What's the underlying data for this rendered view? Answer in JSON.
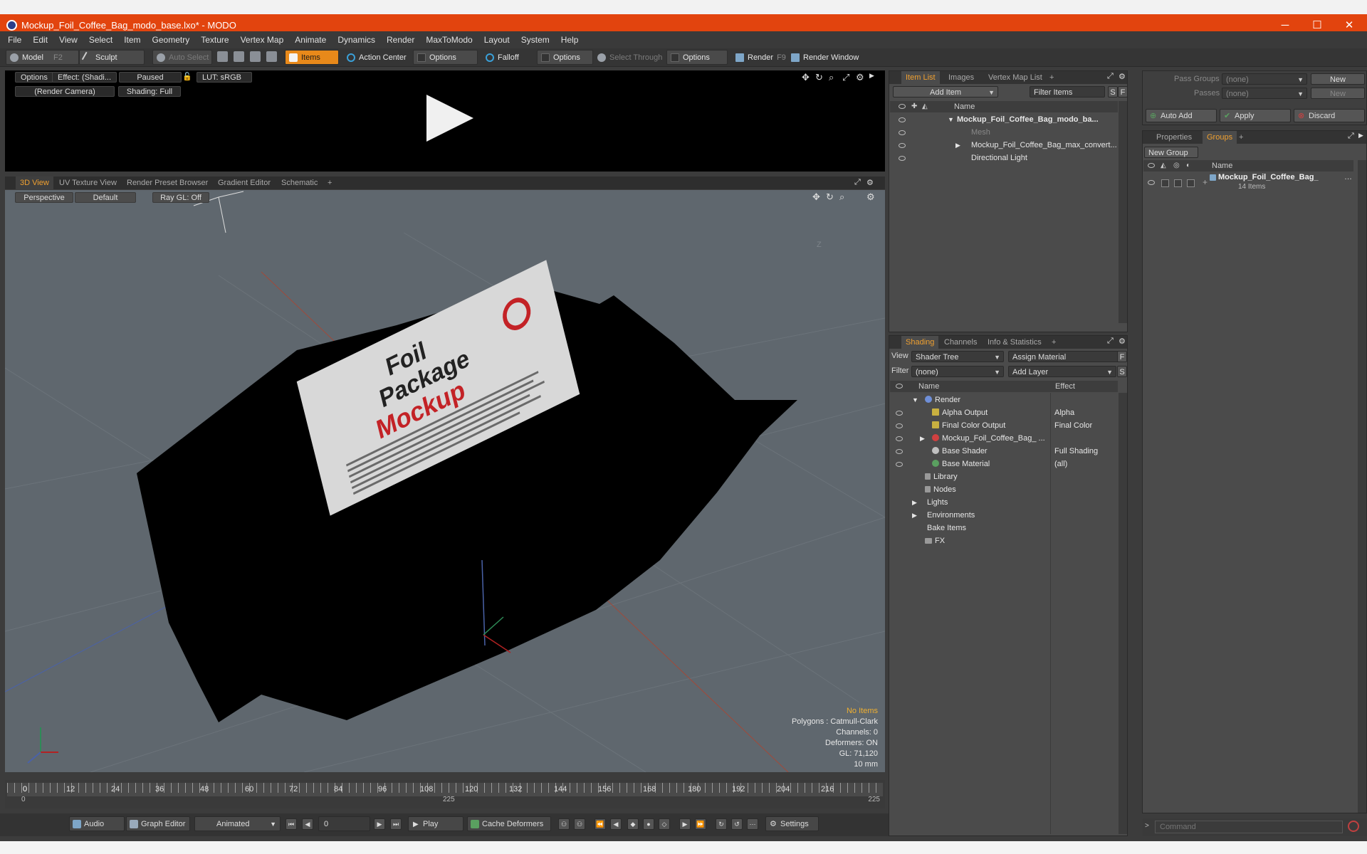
{
  "window": {
    "title": "Mockup_Foil_Coffee_Bag_modo_base.lxo* - MODO",
    "minimize": "─",
    "maximize": "☐",
    "close": "✕"
  },
  "menu": [
    "File",
    "Edit",
    "View",
    "Select",
    "Item",
    "Geometry",
    "Texture",
    "Vertex Map",
    "Animate",
    "Dynamics",
    "Render",
    "MaxToModo",
    "Layout",
    "System",
    "Help"
  ],
  "toolbar": {
    "model": "Model",
    "model_key": "F2",
    "sculpt": "Sculpt",
    "auto_select": "Auto Select",
    "items": "Items",
    "action_center": "Action Center",
    "options1": "Options",
    "falloff": "Falloff",
    "options2": "Options",
    "select_through": "Select Through",
    "options3": "Options",
    "render": "Render",
    "render_key": "F9",
    "render_window": "Render Window"
  },
  "preview": {
    "options": "Options",
    "effect": "Effect: (Shadi...",
    "paused": "Paused",
    "lut": "LUT: sRGB",
    "camera": "(Render Camera)",
    "shading": "Shading: Full"
  },
  "viewport_tabs": [
    "3D View",
    "UV Texture View",
    "Render Preset Browser",
    "Gradient Editor",
    "Schematic",
    "+"
  ],
  "viewport": {
    "perspective": "Perspective",
    "default": "Default",
    "raygl": "Ray GL: Off",
    "axis_label": "Z",
    "package_text": {
      "line1": "Foil",
      "line2": "Package",
      "line3": "Mockup"
    },
    "info": {
      "no_items": "No Items",
      "polygons": "Polygons : Catmull-Clark",
      "channels": "Channels: 0",
      "deformers": "Deformers: ON",
      "gl": "GL: 71,120",
      "unit": "10 mm"
    }
  },
  "timeline": {
    "ticks": [
      "0",
      "12",
      "24",
      "36",
      "48",
      "60",
      "72",
      "84",
      "96",
      "108",
      "120",
      "132",
      "144",
      "156",
      "168",
      "180",
      "192",
      "204",
      "216"
    ],
    "range_start": "0",
    "range_mid": "225",
    "range_end": "225"
  },
  "bottombar": {
    "audio": "Audio",
    "graph_editor": "Graph Editor",
    "animated": "Animated",
    "frame": "0",
    "play": "Play",
    "cache_deformers": "Cache Deformers",
    "settings": "Settings"
  },
  "item_list": {
    "tabs": [
      "Item List",
      "Images",
      "Vertex Map List",
      "+"
    ],
    "add_item": "Add Item",
    "filter_items": "Filter Items",
    "s": "S",
    "f": "F",
    "col_name": "Name",
    "rows": [
      "Mockup_Foil_Coffee_Bag_modo_ba...",
      "Mesh",
      "Mockup_Foil_Coffee_Bag_max_convert...",
      "Directional Light"
    ]
  },
  "shading": {
    "tabs": [
      "Shading",
      "Channels",
      "Info & Statistics",
      "+"
    ],
    "view_label": "View",
    "view_value": "Shader Tree",
    "assign_material": "Assign Material",
    "f": "F",
    "filter_label": "Filter",
    "filter_value": "(none)",
    "add_layer": "Add Layer",
    "s": "S",
    "col_name": "Name",
    "col_effect": "Effect",
    "rows": [
      {
        "name": "Render",
        "effect": ""
      },
      {
        "name": "Alpha Output",
        "effect": "Alpha"
      },
      {
        "name": "Final Color Output",
        "effect": "Final Color"
      },
      {
        "name": "Mockup_Foil_Coffee_Bag_ ...",
        "effect": ""
      },
      {
        "name": "Base Shader",
        "effect": "Full Shading"
      },
      {
        "name": "Base Material",
        "effect": "(all)"
      },
      {
        "name": "Library",
        "effect": ""
      },
      {
        "name": "Nodes",
        "effect": ""
      },
      {
        "name": "Lights",
        "effect": ""
      },
      {
        "name": "Environments",
        "effect": ""
      },
      {
        "name": "Bake Items",
        "effect": ""
      },
      {
        "name": "FX",
        "effect": ""
      }
    ]
  },
  "passes": {
    "pass_groups_label": "Pass Groups",
    "pass_groups_value": "(none)",
    "new": "New",
    "passes_label": "Passes",
    "passes_value": "(none)",
    "new2": "New",
    "auto_add": "Auto Add",
    "apply": "Apply",
    "discard": "Discard"
  },
  "groups": {
    "tabs": [
      "Properties",
      "Groups",
      "+"
    ],
    "new_group": "New Group",
    "col_name": "Name",
    "group_name": "Mockup_Foil_Coffee_Bag_",
    "group_count": "14 Items"
  },
  "command": {
    "placeholder": "Command"
  },
  "colors": {
    "accent": "#f0a030",
    "titlebar": "#e2440e",
    "items_button": "#e8891a"
  }
}
